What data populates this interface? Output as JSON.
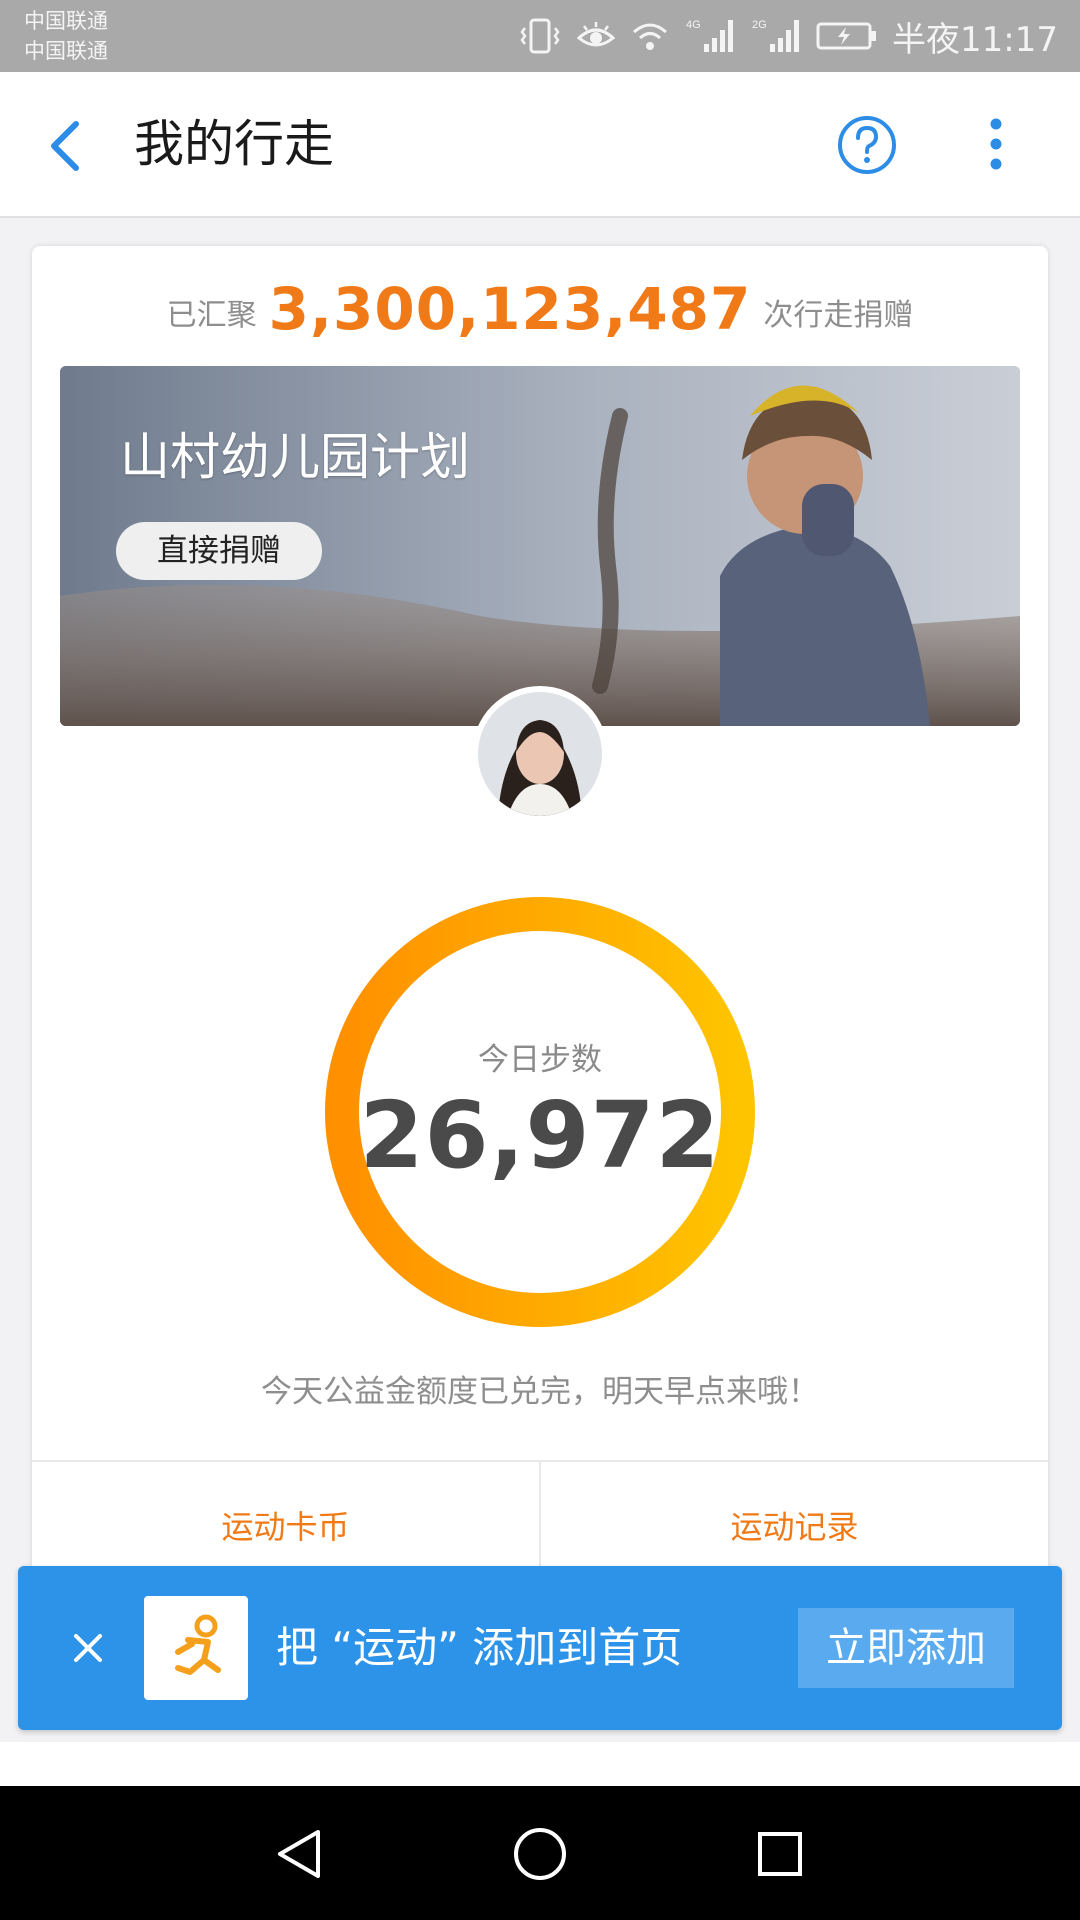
{
  "status_bar": {
    "carrier1": "中国联通",
    "carrier2": "中国联通",
    "net1": "4G",
    "net2": "2G",
    "time": "半夜11:17"
  },
  "header": {
    "title": "我的行走",
    "icons": [
      "back-arrow-icon",
      "help-icon",
      "more-vertical-icon"
    ]
  },
  "summary": {
    "prefix": "已汇聚",
    "total": "3,300,123,487",
    "suffix": "次行走捐赠"
  },
  "banner": {
    "title": "山村幼儿园计划",
    "donate_label": "直接捐赠"
  },
  "steps": {
    "label": "今日步数",
    "value": "26,972",
    "ring_colors": [
      "#ff9000",
      "#ffc400"
    ]
  },
  "notice": "今天公益金额度已兑完，明天早点来哦！",
  "actions": {
    "coins": "运动卡币",
    "records": "运动记录"
  },
  "promo": {
    "text": "把 “运动” 添加到首页",
    "button": "立即添加",
    "icon": "running-man-icon"
  },
  "colors": {
    "accent_orange": "#f07a18",
    "brand_blue": "#2d93e8"
  }
}
